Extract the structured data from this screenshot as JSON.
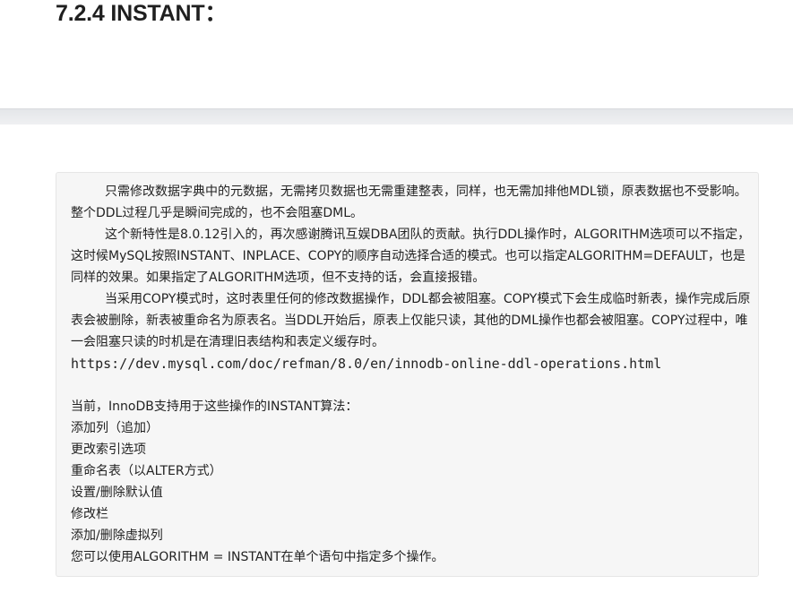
{
  "heading": "7.2.4 INSTANT：",
  "paragraphs": [
    "只需修改数据字典中的元数据，无需拷贝数据也无需重建整表，同样，也无需加排他MDL锁，原表数据也不受影响。整个DDL过程几乎是瞬间完成的，也不会阻塞DML。",
    "这个新特性是8.0.12引入的，再次感谢腾讯互娱DBA团队的贡献。执行DDL操作时，ALGORITHM选项可以不指定，这时候MySQL按照INSTANT、INPLACE、COPY的顺序自动选择合适的模式。也可以指定ALGORITHM=DEFAULT，也是同样的效果。如果指定了ALGORITHM选项，但不支持的话，会直接报错。",
    "当采用COPY模式时，这时表里任何的修改数据操作，DDL都会被阻塞。COPY模式下会生成临时新表，操作完成后原表会被删除，新表被重命名为原表名。当DDL开始后，原表上仅能只读，其他的DML操作也都会被阻塞。COPY过程中，唯一会阻塞只读的时机是在清理旧表结构和表定义缓存时。"
  ],
  "url": "https://dev.mysql.com/doc/refman/8.0/en/innodb-online-ddl-operations.html",
  "intro": "当前，InnoDB支持用于这些操作的INSTANT算法：",
  "operations": [
    "添加列（追加）",
    "更改索引选项",
    "重命名表（以ALTER方式）",
    "设置/删除默认值",
    "修改栏",
    "添加/删除虚拟列"
  ],
  "closing": "您可以使用ALGORITHM = INSTANT在单个语句中指定多个操作。"
}
